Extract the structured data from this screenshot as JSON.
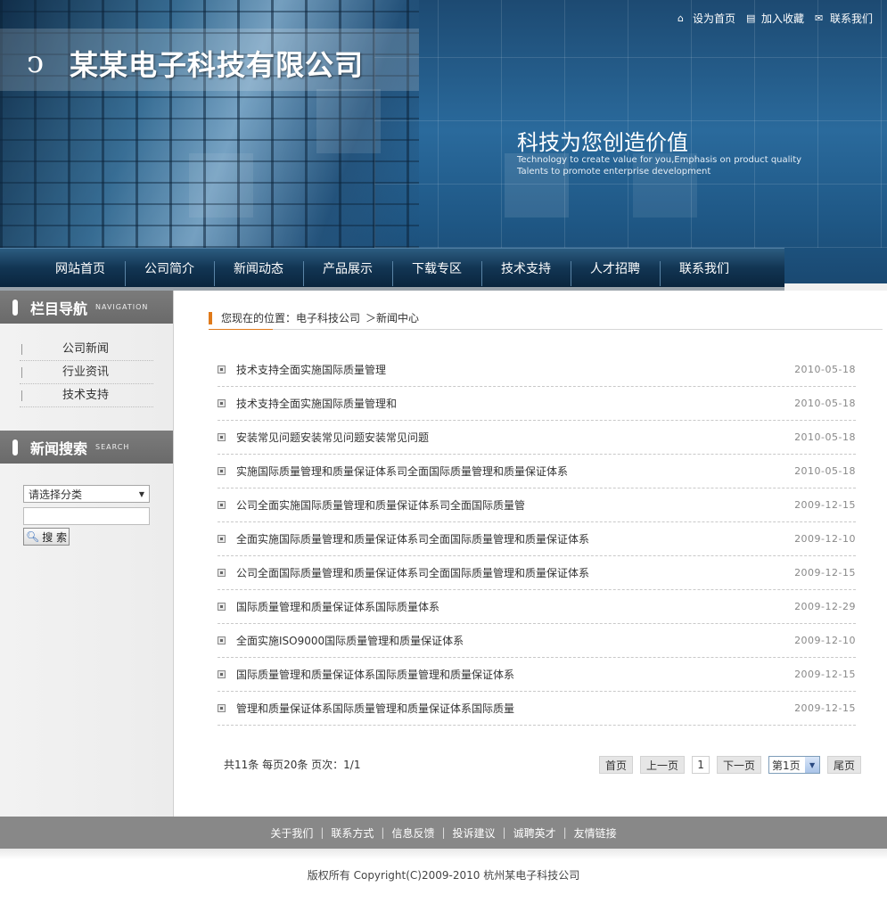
{
  "header": {
    "company_name": "某某电子科技有限公司",
    "top_links": [
      {
        "label": "设为首页",
        "icon": "home-icon"
      },
      {
        "label": "加入收藏",
        "icon": "bookmark-icon"
      },
      {
        "label": "联系我们",
        "icon": "contact-icon"
      }
    ],
    "slogan": "科技为您创造价值",
    "slogan_en_line1": "Technology to create value for you,Emphasis on product quality",
    "slogan_en_line2": "Talents to promote enterprise development"
  },
  "nav": {
    "items": [
      "网站首页",
      "公司简介",
      "新闻动态",
      "产品展示",
      "下载专区",
      "技术支持",
      "人才招聘",
      "联系我们"
    ]
  },
  "sidebar": {
    "nav_title": "栏目导航",
    "nav_title_en": "NAVIGATION",
    "nav_items": [
      "公司新闻",
      "行业资讯",
      "技术支持"
    ],
    "search_title": "新闻搜索",
    "search_title_en": "SEARCH",
    "category_select": "请选择分类",
    "search_button": "搜 索"
  },
  "breadcrumb": {
    "prefix": "您现在的位置：电子科技公司",
    "current": "＞新闻中心"
  },
  "news": [
    {
      "title": "技术支持全面实施国际质量管理",
      "date": "2010-05-18"
    },
    {
      "title": "技术支持全面实施国际质量管理和",
      "date": "2010-05-18"
    },
    {
      "title": "安装常见问题安装常见问题安装常见问题",
      "date": "2010-05-18"
    },
    {
      "title": "实施国际质量管理和质量保证体系司全面国际质量管理和质量保证体系",
      "date": "2010-05-18"
    },
    {
      "title": "公司全面实施国际质量管理和质量保证体系司全面国际质量管",
      "date": "2009-12-15"
    },
    {
      "title": "全面实施国际质量管理和质量保证体系司全面国际质量管理和质量保证体系",
      "date": "2009-12-10"
    },
    {
      "title": "公司全面国际质量管理和质量保证体系司全面国际质量管理和质量保证体系",
      "date": "2009-12-15"
    },
    {
      "title": "国际质量管理和质量保证体系国际质量体系",
      "date": "2009-12-29"
    },
    {
      "title": "全面实施ISO9000国际质量管理和质量保证体系",
      "date": "2009-12-10"
    },
    {
      "title": "国际质量管理和质量保证体系国际质量管理和质量保证体系",
      "date": "2009-12-15"
    },
    {
      "title": "管理和质量保证体系国际质量管理和质量保证体系国际质量",
      "date": "2009-12-15"
    }
  ],
  "pager": {
    "info": "共11条  每页20条  页次：1/1",
    "first": "首页",
    "prev": "上一页",
    "current": "1",
    "next": "下一页",
    "select": "第1页",
    "last": "尾页"
  },
  "footer": {
    "links": [
      "关于我们",
      "联系方式",
      "信息反馈",
      "投诉建议",
      "诚聘英才",
      "友情链接"
    ],
    "copyright": "版权所有  Copyright(C)2009-2010 杭州某电子科技公司"
  },
  "colors": {
    "header_blue": "#1f5886",
    "nav_dark": "#123553",
    "accent_orange": "#e07a1a",
    "footer_gray": "#888888"
  }
}
